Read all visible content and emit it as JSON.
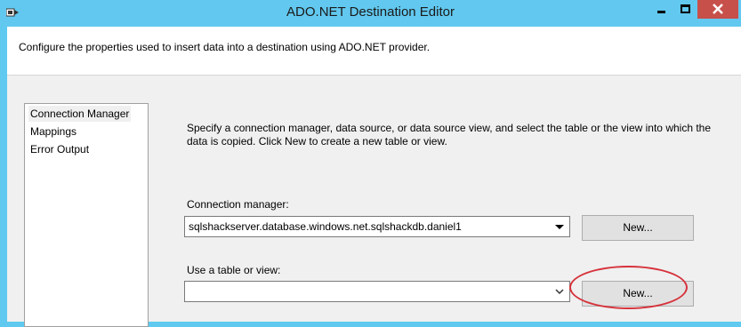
{
  "window": {
    "title": "ADO.NET Destination Editor"
  },
  "header": {
    "description": "Configure the properties used to insert data into a destination using ADO.NET provider."
  },
  "nav": {
    "items": [
      {
        "label": "Connection Manager",
        "selected": true
      },
      {
        "label": "Mappings",
        "selected": false
      },
      {
        "label": "Error Output",
        "selected": false
      }
    ]
  },
  "main": {
    "instructions": "Specify a connection manager, data source, or data source view, and select the table or the view into which the data is copied. Click New to create a new table or view.",
    "connection_manager": {
      "label": "Connection manager:",
      "value": "sqlshackserver.database.windows.net.sqlshackdb.daniel1",
      "new_label": "New..."
    },
    "table_or_view": {
      "label": "Use a table or view:",
      "value": "",
      "new_label": "New..."
    }
  },
  "colors": {
    "titlebar": "#62c8ef",
    "close_button": "#c7504b",
    "highlight": "#d6323b"
  },
  "icons": [
    "app-icon",
    "minimize-icon",
    "maximize-icon",
    "close-icon",
    "dropdown-arrow-icon"
  ]
}
